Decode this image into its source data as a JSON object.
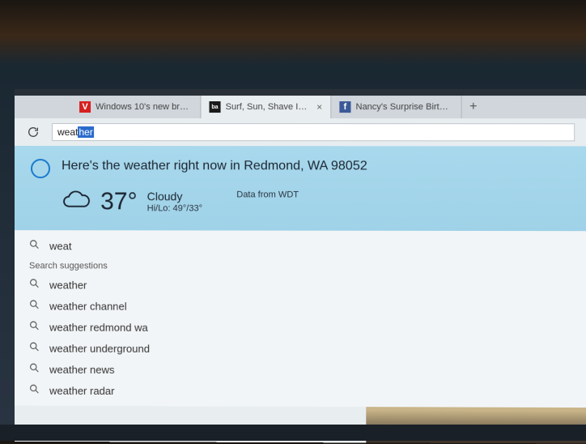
{
  "tabs": [
    {
      "favicon": "V",
      "label": "Windows 10's new browser w..."
    },
    {
      "favicon": "ba",
      "label": "Surf, Sun, Shave Ice, and..."
    },
    {
      "favicon": "f",
      "label": "Nancy's Surprise Birthday Par..."
    }
  ],
  "address_bar": {
    "typed": "weat",
    "autocomplete": "her"
  },
  "cortana": {
    "heading": "Here's the weather right now in Redmond, WA 98052",
    "temperature": "37°",
    "condition": "Cloudy",
    "hilo": "Hi/Lo: 49°/33°",
    "source": "Data from WDT"
  },
  "suggestions": {
    "top": "weat",
    "header": "Search suggestions",
    "items": [
      "weather",
      "weather channel",
      "weather redmond wa",
      "weather underground",
      "weather news",
      "weather radar"
    ]
  }
}
